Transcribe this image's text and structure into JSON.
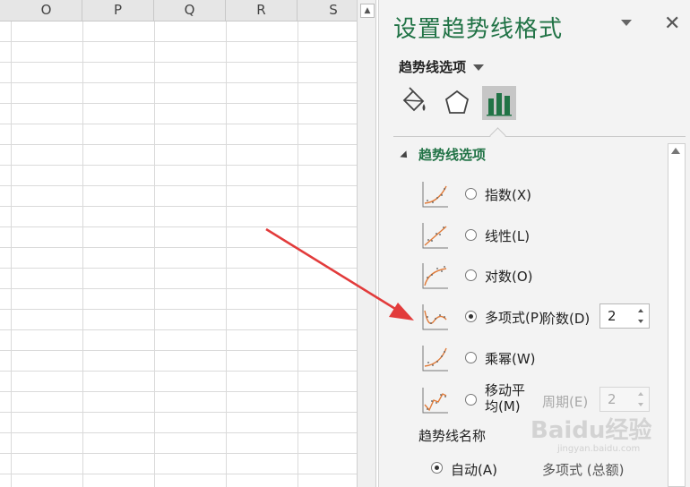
{
  "sheet": {
    "columns": [
      "O",
      "P",
      "Q",
      "R",
      "S"
    ]
  },
  "pane": {
    "title": "设置趋势线格式",
    "options_menu": "趋势线选项",
    "tabs": [
      {
        "icon": "fill-bucket-icon",
        "selected": false
      },
      {
        "icon": "pentagon-effects-icon",
        "selected": false
      },
      {
        "icon": "bar-chart-icon",
        "selected": true
      }
    ],
    "section_title": "趋势线选项",
    "trend_types": [
      {
        "icon": "exponential-trend-icon",
        "label": "指数(X)",
        "checked": false
      },
      {
        "icon": "linear-trend-icon",
        "label": "线性(L)",
        "checked": false
      },
      {
        "icon": "logarithmic-trend-icon",
        "label": "对数(O)",
        "checked": false
      },
      {
        "icon": "polynomial-trend-icon",
        "label": "多项式(P)",
        "checked": true,
        "param_label": "阶数(D)",
        "param_value": "2"
      },
      {
        "icon": "power-trend-icon",
        "label": "乘幂(W)",
        "checked": false
      },
      {
        "icon": "moving-average-trend-icon",
        "label": "移动平均(M)",
        "checked": false,
        "param_label": "周期(E)",
        "param_value": "2"
      }
    ],
    "name_label": "趋势线名称",
    "auto_label": "自动(A)",
    "auto_value": "多项式 (总额)"
  },
  "watermark": {
    "text": "Baidu经验",
    "sub": "jingyan.baidu.com"
  },
  "colors": {
    "accent": "#217346",
    "arrow": "#e23b3b",
    "trend_line": "#e07b39"
  }
}
